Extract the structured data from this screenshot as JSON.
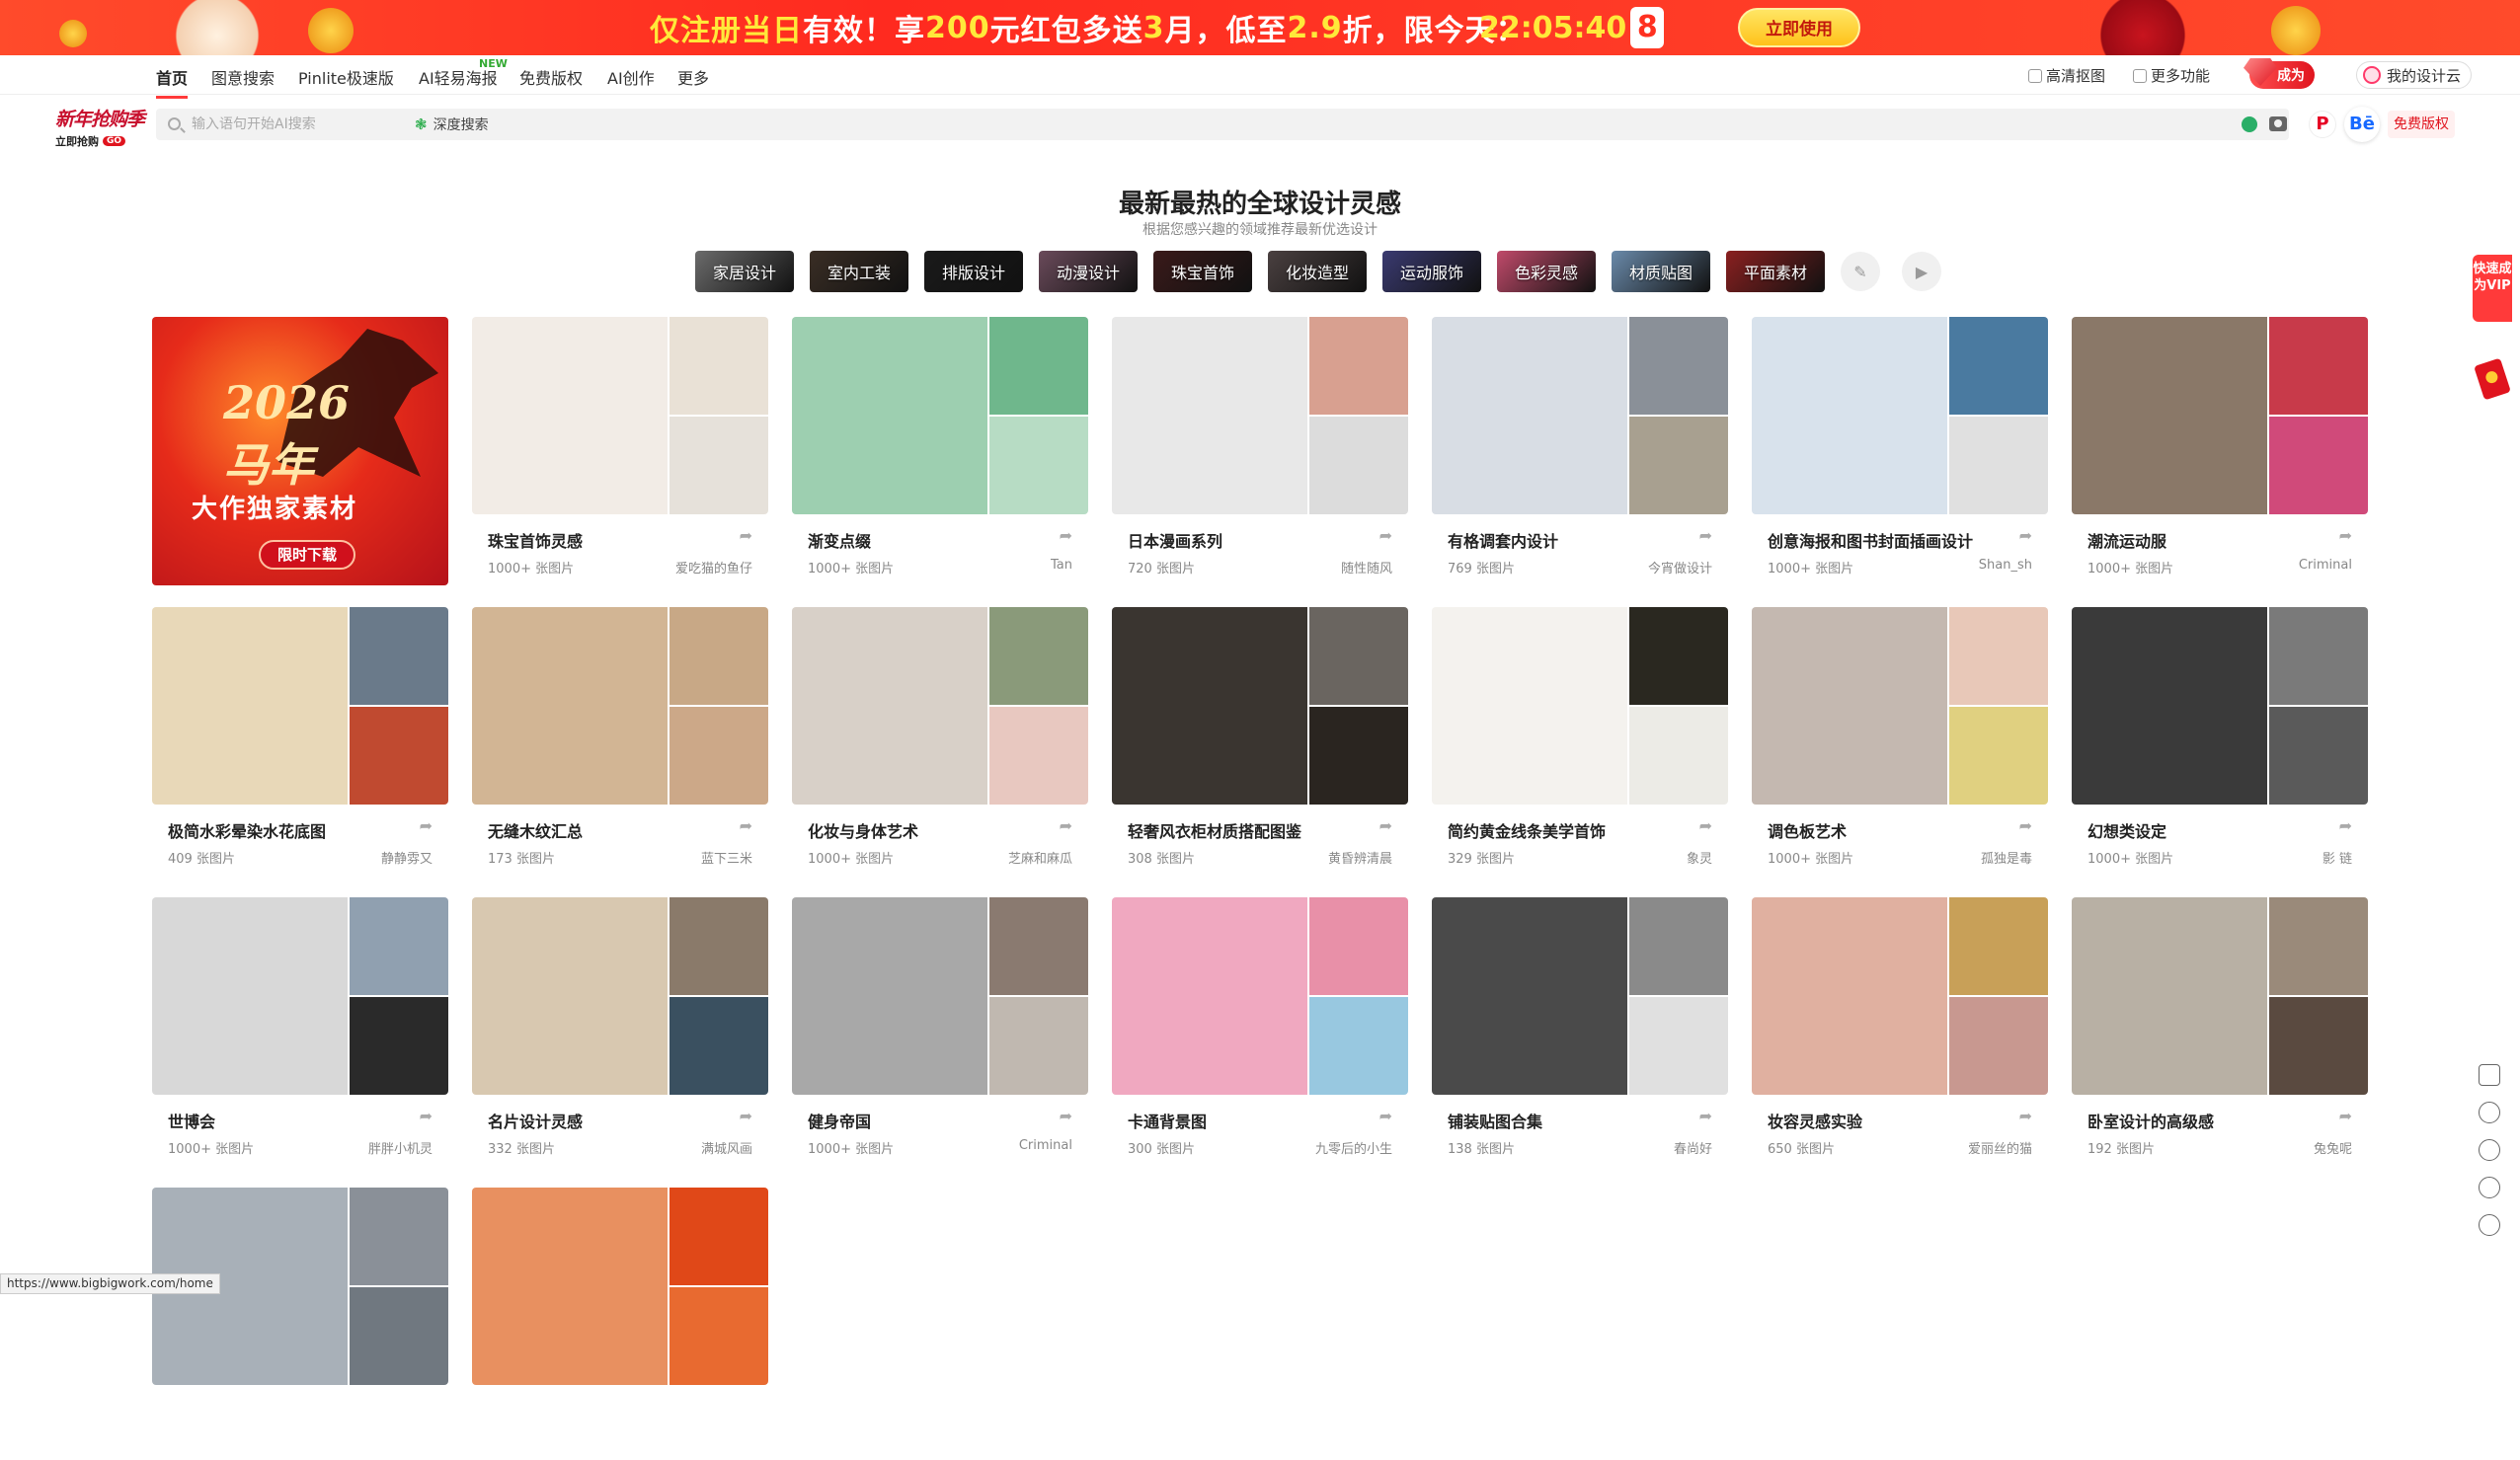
{
  "promo": {
    "text_a": "仅注册当日",
    "text_b": "有效！享",
    "text_c": "200",
    "text_d": "元红包多送",
    "text_e": "3",
    "text_f": "月，低至",
    "text_g": "2.9",
    "text_h": "折，限今天：",
    "clock": "22:05:40",
    "clock_digit": "8",
    "button": "立即使用"
  },
  "nav": {
    "items": [
      "首页",
      "图意搜索",
      "Pinlite极速版",
      "AI轻易海报",
      "免费版权",
      "AI创作",
      "更多"
    ],
    "new_badge": "NEW",
    "right": {
      "cutout": "高清抠图",
      "more": "更多功能",
      "vip": "成为",
      "cloud": "我的设计云"
    }
  },
  "logo": {
    "top": "新年抢购季",
    "bottom": "立即抢购",
    "go": "GO"
  },
  "search": {
    "placeholder": "输入语句开始AI搜索",
    "deep": "深度搜索",
    "free": "免费版权"
  },
  "heading": {
    "title": "最新最热的全球设计灵感",
    "subtitle": "根据您感兴趣的领域推荐最新优选设计"
  },
  "chips": [
    {
      "label": "家居设计",
      "color": "#6b6b6b"
    },
    {
      "label": "室内工装",
      "color": "#3a2e25"
    },
    {
      "label": "排版设计",
      "color": "#1a1a1a"
    },
    {
      "label": "动漫设计",
      "color": "#6a4a5a"
    },
    {
      "label": "珠宝首饰",
      "color": "#3a1a1a"
    },
    {
      "label": "化妆造型",
      "color": "#4a4040"
    },
    {
      "label": "运动服饰",
      "color": "#3a3a70"
    },
    {
      "label": "色彩灵感",
      "color": "#c04a6a"
    },
    {
      "label": "材质贴图",
      "color": "#6a8aaa"
    },
    {
      "label": "平面素材",
      "color": "#8a2020"
    }
  ],
  "ad": {
    "year": "2026",
    "line2": "马年",
    "sub": "大作独家素材",
    "button": "限时下载"
  },
  "cards": [
    {
      "title": "珠宝首饰灵感",
      "count": "1000+ 张图片",
      "author": "爱吃猫的鱼仔",
      "c": [
        "#f2ece6",
        "#e9e1d6",
        "#e6e1da"
      ]
    },
    {
      "title": "渐变点缀",
      "count": "1000+ 张图片",
      "author": "Tan",
      "c": [
        "#9dcfb0",
        "#6fb78c",
        "#b7dcc4"
      ]
    },
    {
      "title": "日本漫画系列",
      "count": "720 张图片",
      "author": "随性随风",
      "c": [
        "#e8e8e8",
        "#d8a090",
        "#dcdcdc"
      ]
    },
    {
      "title": "有格调套内设计",
      "count": "769 张图片",
      "author": "今宵做设计",
      "c": [
        "#d8dde4",
        "#8a9098",
        "#a8a090"
      ]
    },
    {
      "title": "创意海报和图书封面插画设计",
      "count": "1000+ 张图片",
      "author": "Shan_sh",
      "c": [
        "#d8e2ec",
        "#4a7aa0",
        "#e0e0e0"
      ]
    },
    {
      "title": "潮流运动服",
      "count": "1000+ 张图片",
      "author": "Criminal",
      "c": [
        "#8a7868",
        "#c83a4a",
        "#d04a7a"
      ]
    },
    {
      "title": "极简水彩晕染水花底图",
      "count": "409 张图片",
      "author": "静静雰又",
      "c": [
        "#e8d8b8",
        "#6a7a8a",
        "#c04a30"
      ]
    },
    {
      "title": "无缝木纹汇总",
      "count": "173 张图片",
      "author": "蓝下三米",
      "c": [
        "#d2b594",
        "#c8a886",
        "#cca888"
      ]
    },
    {
      "title": "化妆与身体艺术",
      "count": "1000+ 张图片",
      "author": "芝麻和麻瓜",
      "c": [
        "#d8d0c8",
        "#8a9a7a",
        "#e8c8c0"
      ]
    },
    {
      "title": "轻奢风衣柜材质搭配图鉴",
      "count": "308 张图片",
      "author": "黄昏辨清晨",
      "c": [
        "#3a3530",
        "#6a6560",
        "#2a2520"
      ]
    },
    {
      "title": "简约黄金线条美学首饰",
      "count": "329 张图片",
      "author": "象灵",
      "c": [
        "#f4f2ee",
        "#2a2820",
        "#ecebe6"
      ]
    },
    {
      "title": "调色板艺术",
      "count": "1000+ 张图片",
      "author": "孤独是毒",
      "c": [
        "#c4b8b0",
        "#e8c8b8",
        "#e0d080"
      ]
    },
    {
      "title": "幻想类设定",
      "count": "1000+ 张图片",
      "author": "影 链",
      "c": [
        "#3a3a3a",
        "#7a7a7a",
        "#5a5a5a"
      ]
    },
    {
      "title": "世博会",
      "count": "1000+ 张图片",
      "author": "胖胖小机灵",
      "c": [
        "#d8d8d8",
        "#90a0b0",
        "#2a2a2a"
      ]
    },
    {
      "title": "名片设计灵感",
      "count": "332 张图片",
      "author": "满城风画",
      "c": [
        "#d8c8b0",
        "#8a7a6a",
        "#3a5060"
      ]
    },
    {
      "title": "健身帝国",
      "count": "1000+ 张图片",
      "author": "Criminal",
      "c": [
        "#a8a8a8",
        "#8a7a70",
        "#c0b8b0"
      ]
    },
    {
      "title": "卡通背景图",
      "count": "300 张图片",
      "author": "九零后的小生",
      "c": [
        "#f0a8c0",
        "#e890a8",
        "#98c8e0"
      ]
    },
    {
      "title": "铺装贴图合集",
      "count": "138 张图片",
      "author": "春尚好",
      "c": [
        "#4a4a4a",
        "#8a8a8a",
        "#e0e0e0"
      ]
    },
    {
      "title": "妆容灵感实验",
      "count": "650 张图片",
      "author": "爱丽丝的猫",
      "c": [
        "#e0b0a0",
        "#c8a058",
        "#c89890"
      ]
    },
    {
      "title": "卧室设计的高级感",
      "count": "192 张图片",
      "author": "兔兔呢",
      "c": [
        "#b8b0a4",
        "#9a8a7a",
        "#5a4a40"
      ]
    },
    {
      "title": "",
      "count": "",
      "author": "",
      "c": [
        "#a8b0b8",
        "#8a9098",
        "#707880"
      ]
    },
    {
      "title": "",
      "count": "",
      "author": "",
      "c": [
        "#e89060",
        "#e04818",
        "#e86a30"
      ]
    }
  ],
  "side": {
    "vip": "快速成为VIP"
  },
  "status": {
    "url": "https://www.bigbigwork.com/home"
  }
}
